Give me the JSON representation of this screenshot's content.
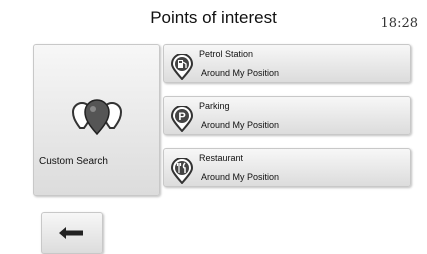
{
  "header": {
    "title": "Points of interest",
    "time": "18:28"
  },
  "custom_search": {
    "label": "Custom Search",
    "icon": "group-pins-icon"
  },
  "categories": [
    {
      "name": "Petrol Station",
      "subtitle": "Around My Position",
      "icon": "fuel-pump-pin-icon"
    },
    {
      "name": "Parking",
      "subtitle": "Around My Position",
      "icon": "parking-pin-icon"
    },
    {
      "name": "Restaurant",
      "subtitle": "Around My Position",
      "icon": "cutlery-pin-icon"
    }
  ],
  "back_button": {
    "icon": "back-arrow-icon"
  },
  "colors": {
    "card_top": "#f7f7f7",
    "card_bottom": "#dcdcdc",
    "icon_dark": "#333333"
  }
}
